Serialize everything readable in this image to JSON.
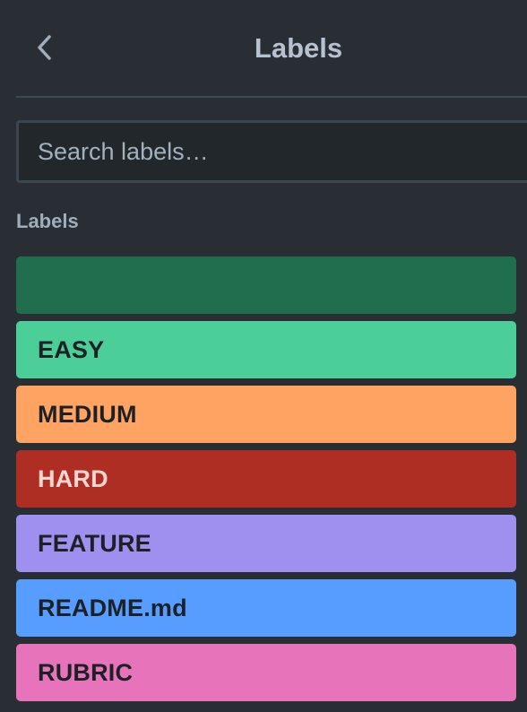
{
  "header": {
    "title": "Labels",
    "back_icon": "chevron-left-icon"
  },
  "search": {
    "placeholder": "Search labels…"
  },
  "section": {
    "title": "Labels"
  },
  "labels": [
    {
      "text": "",
      "color": "#216e4e",
      "text_color": "#1d2125"
    },
    {
      "text": "EASY",
      "color": "#4bce97",
      "text_color": "#1d2125"
    },
    {
      "text": "MEDIUM",
      "color": "#fea362",
      "text_color": "#1d2125"
    },
    {
      "text": "HARD",
      "color": "#ae2e24",
      "text_color": "#ffd5d2"
    },
    {
      "text": "FEATURE",
      "color": "#9f8fef",
      "text_color": "#1d2125"
    },
    {
      "text": "README.md",
      "color": "#579dff",
      "text_color": "#1d2125"
    },
    {
      "text": "RUBRIC",
      "color": "#e774bb",
      "text_color": "#1d2125"
    }
  ]
}
